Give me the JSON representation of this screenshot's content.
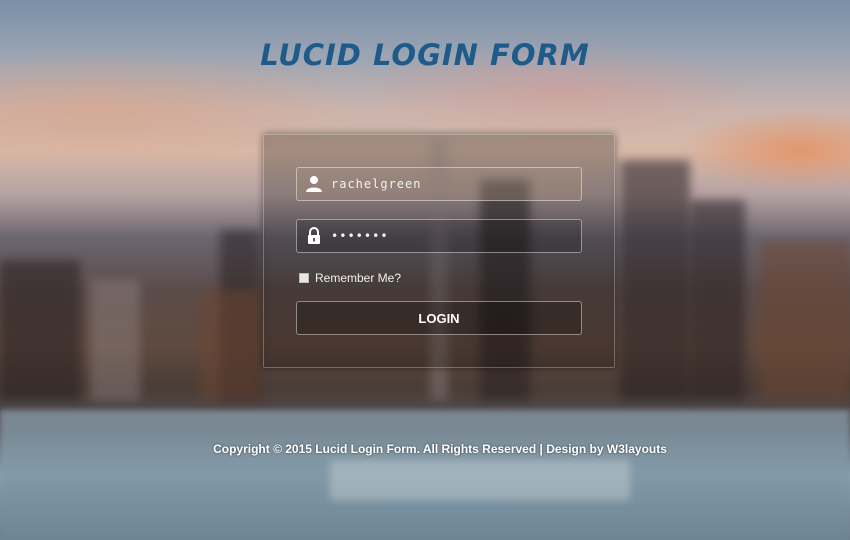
{
  "page": {
    "title": "LUCID LOGIN FORM",
    "accent_color": "#1e5a8a"
  },
  "form": {
    "username": {
      "icon": "user-icon",
      "value": "rachelgreen"
    },
    "password": {
      "icon": "lock-icon",
      "value": "•••••••"
    },
    "remember_label": "Remember Me?",
    "remember_checked": false,
    "login_label": "LOGIN"
  },
  "footer": {
    "text": "Copyright © 2015 Lucid Login Form. All Rights Reserved | Design by W3layouts"
  }
}
